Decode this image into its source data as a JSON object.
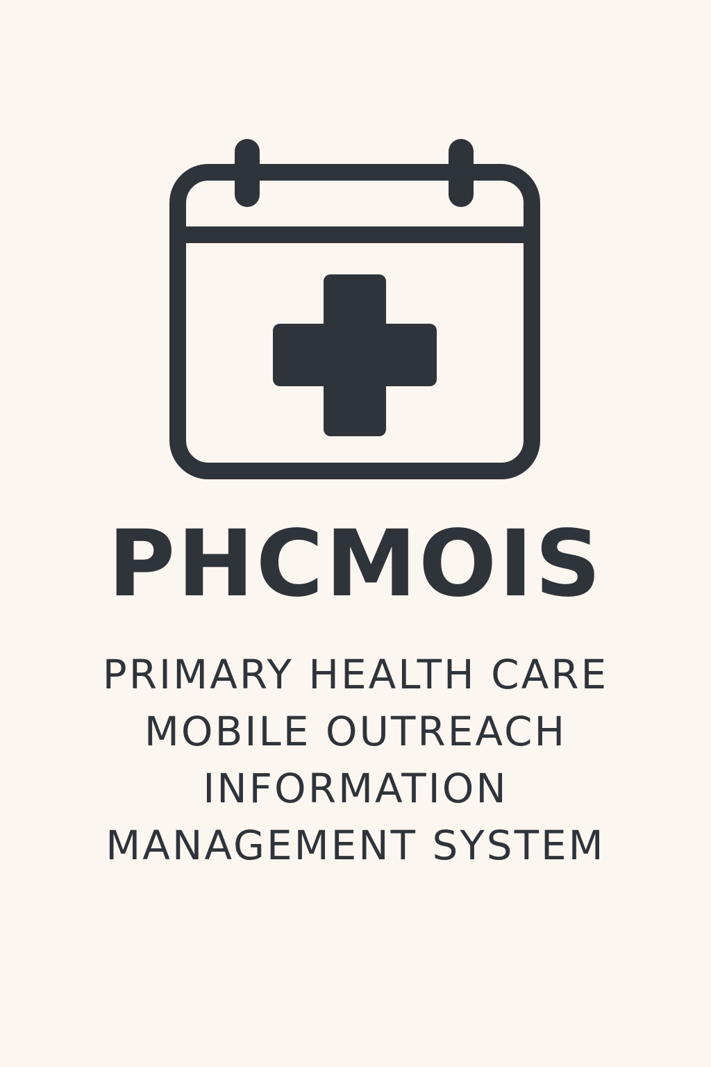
{
  "app": {
    "title": "PHCMOIS",
    "subtitle_lines": [
      "PRIMARY HEALTH CARE",
      "MOBILE OUTREACH",
      "INFORMATION",
      "MANAGEMENT SYSTEM"
    ]
  },
  "icons": {
    "main": "calendar-medical-cross-icon"
  },
  "colors": {
    "background": "#fcf6f1",
    "ink": "#2e3439"
  }
}
